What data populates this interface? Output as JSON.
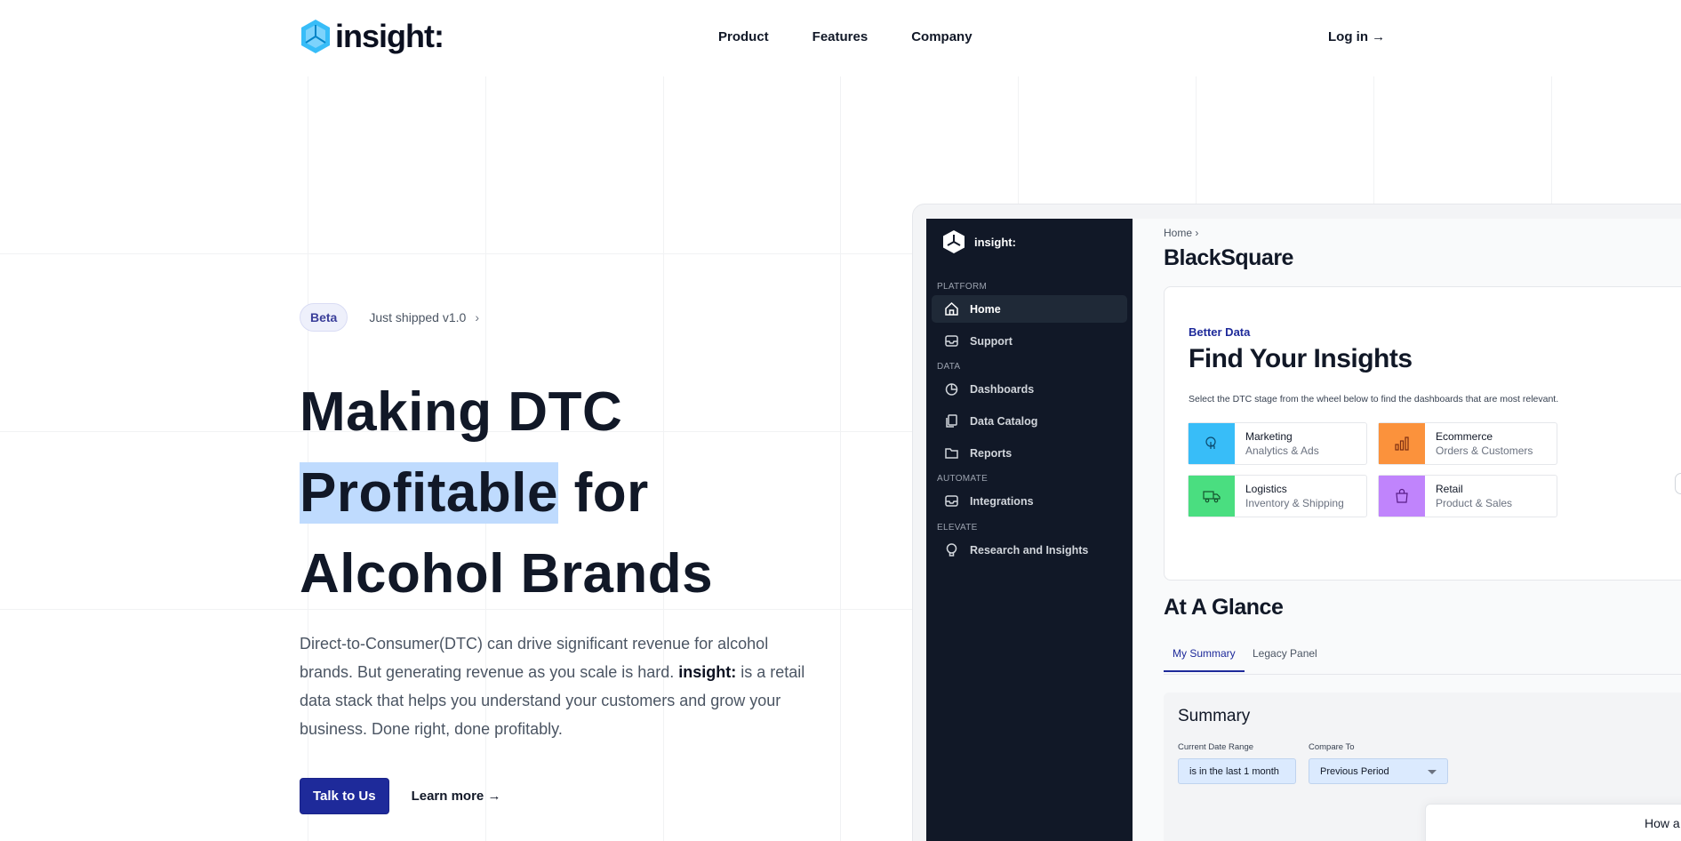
{
  "header": {
    "logo_text": "insight:",
    "nav": [
      "Product",
      "Features",
      "Company"
    ],
    "login": "Log in →"
  },
  "hero": {
    "badge": "Beta",
    "badge_text": "Just shipped v1.0",
    "title_line1": "Making DTC",
    "title_highlight": "Profitable",
    "title_line2_rest": " for",
    "title_line3": "Alcohol Brands",
    "desc_part1": "Direct-to-Consumer(DTC) can drive significant revenue for alcohol brands. But generating revenue as you scale is hard. ",
    "desc_brand": "insight:",
    "desc_part2": " is a retail data stack that helps you understand your customers and grow your business. Done right, done profitably.",
    "cta_primary": "Talk to Us",
    "cta_secondary": "Learn more →"
  },
  "app": {
    "sidebar": {
      "logo_text": "insight:",
      "sections": {
        "platform": "PLATFORM",
        "data": "DATA",
        "automate": "AUTOMATE",
        "elevate": "ELEVATE"
      },
      "items": {
        "home": "Home",
        "support": "Support",
        "dashboards": "Dashboards",
        "catalog": "Data Catalog",
        "reports": "Reports",
        "integrations": "Integrations",
        "research": "Research and Insights"
      }
    },
    "breadcrumb": "Home",
    "org_title": "BlackSquare",
    "card": {
      "kicker": "Better Data",
      "title": "Find Your Insights",
      "desc": "Select the DTC stage from the wheel below to find the dashboards that are most relevant.",
      "tiles": [
        {
          "name": "Marketing",
          "sub": "Analytics & Ads",
          "color": "#38bdf8",
          "icon": "touch-icon"
        },
        {
          "name": "Ecommerce",
          "sub": "Orders & Customers",
          "color": "#fb923c",
          "icon": "bar-chart-icon"
        },
        {
          "name": "Logistics",
          "sub": "Inventory & Shipping",
          "color": "#4ade80",
          "icon": "truck-icon"
        },
        {
          "name": "Retail",
          "sub": "Product & Sales",
          "color": "#c084fc",
          "icon": "shopping-bag-icon"
        }
      ]
    },
    "glance_title": "At A Glance",
    "tabs": [
      "My Summary",
      "Legacy Panel"
    ],
    "summary": {
      "title": "Summary",
      "date_label": "Current Date Range",
      "date_value": "is in the last 1 month",
      "compare_label": "Compare To",
      "compare_value": "Previous Period"
    },
    "popup_text": "How a"
  }
}
